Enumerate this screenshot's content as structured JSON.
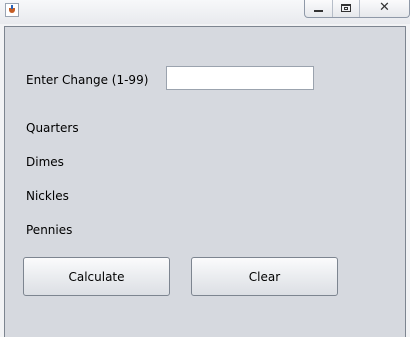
{
  "window": {
    "title": "",
    "icon": "java-cup-icon",
    "controls": {
      "minimize": "minimize-icon",
      "maximize": "maximize-icon",
      "close": "close-icon"
    }
  },
  "form": {
    "change_label": "Enter Change (1-99)",
    "change_value": "",
    "change_placeholder": ""
  },
  "results": {
    "quarters": "Quarters",
    "dimes": "Dimes",
    "nickles": "Nickles",
    "pennies": "Pennies"
  },
  "buttons": {
    "calculate": "Calculate",
    "clear": "Clear"
  }
}
